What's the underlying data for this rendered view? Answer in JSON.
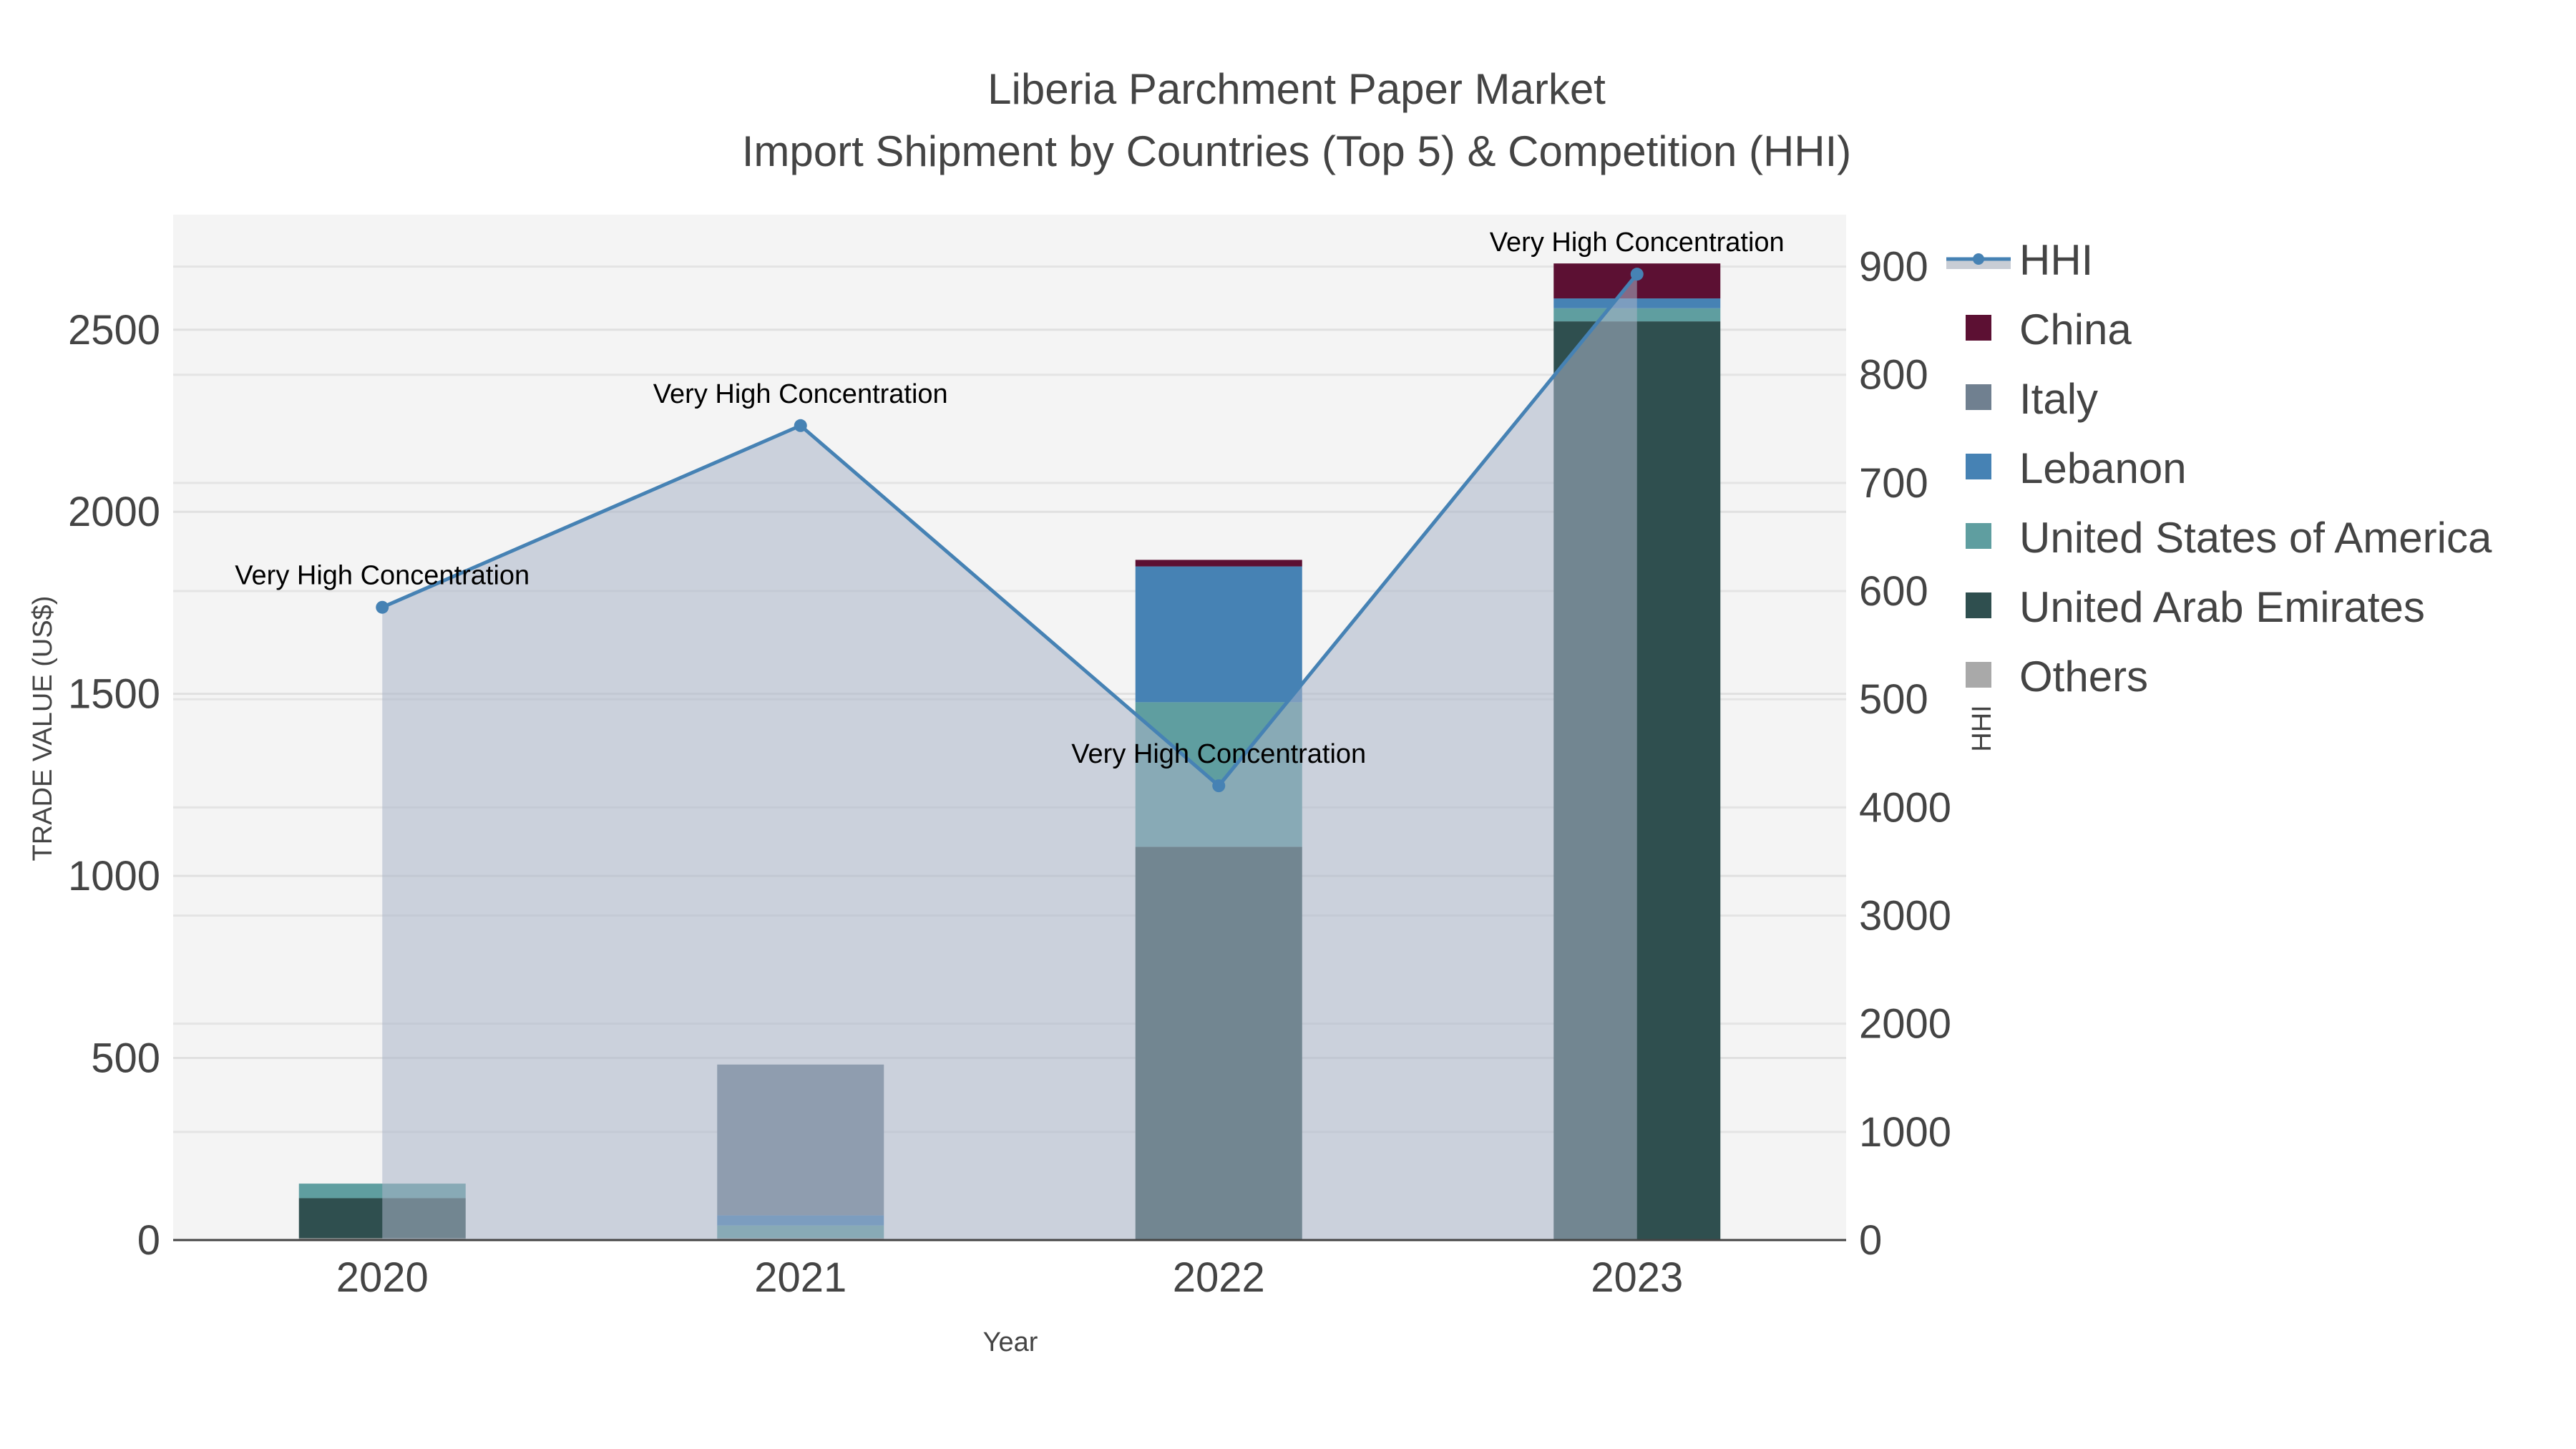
{
  "chart_data": {
    "type": "bar",
    "title": "Liberia Parchment Paper Market",
    "subtitle": "Import Shipment by Countries (Top 5) & Competition (HHI)",
    "xlabel": "Year",
    "ylabel": "TRADE VALUE (US$)",
    "y2label": "HHI",
    "categories": [
      "2020",
      "2021",
      "2022",
      "2023"
    ],
    "ylim": [
      0,
      2816
    ],
    "y_ticks": [
      0,
      500,
      1000,
      1500,
      2000,
      2500
    ],
    "y2lim": [
      0,
      9480
    ],
    "y2_ticks": [
      0,
      1000,
      2000,
      3000,
      4000,
      5000,
      6000,
      7000,
      8000,
      9000
    ],
    "y2_tick_labels": [
      "0",
      "1000",
      "2000",
      "3000",
      "4000",
      "500",
      "600",
      "700",
      "800",
      "900"
    ],
    "grid": true,
    "legend_placement": "right",
    "series": [
      {
        "name": "Others",
        "color": "#a9a9a9",
        "values": [
          5,
          5,
          0,
          0
        ]
      },
      {
        "name": "United Arab Emirates",
        "color": "#2f4f4f",
        "values": [
          110,
          0,
          1080,
          2523
        ]
      },
      {
        "name": "United States of America",
        "color": "#5f9ea0",
        "values": [
          40,
          35,
          397,
          36
        ]
      },
      {
        "name": "Lebanon",
        "color": "#4682b4",
        "values": [
          0,
          28,
          373,
          27
        ]
      },
      {
        "name": "Italy",
        "color": "#708090",
        "values": [
          0,
          414,
          0,
          0
        ]
      },
      {
        "name": "China",
        "color": "#5c1033",
        "values": [
          0,
          0,
          18,
          96
        ]
      }
    ],
    "hhi": {
      "name": "HHI",
      "color": "#4682b4",
      "values": [
        5850,
        7530,
        4200,
        8930
      ]
    },
    "annotations": [
      "Very High Concentration",
      "Very High Concentration",
      "Very High Concentration",
      "Very High Concentration"
    ],
    "legend_order": [
      "HHI",
      "China",
      "Italy",
      "Lebanon",
      "United States of America",
      "United Arab Emirates",
      "Others"
    ]
  }
}
